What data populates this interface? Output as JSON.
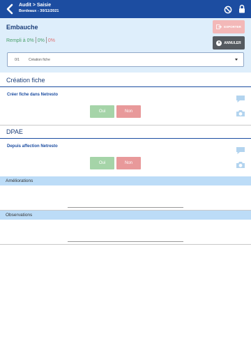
{
  "topbar": {
    "title": "Audit > Saisie",
    "subtitle": "Bordeaux - 30/11/2021",
    "icons": [
      "back-arrow",
      "ban",
      "lock"
    ]
  },
  "header": {
    "title": "Embauche",
    "fill_label": "Rempli à 0%",
    "fill_green": "0%",
    "fill_red": "0%",
    "export_label": "EXPORTER",
    "cancel_label": "ANNULER"
  },
  "select": {
    "number": "0/1",
    "text": "Création fiche"
  },
  "sections": [
    {
      "title": "Création fiche",
      "question": "Créer fiche dans Netresto",
      "yes_label": "Oui",
      "no_label": "Non"
    },
    {
      "title": "DPAE",
      "question": "Depuis affection Netresto",
      "yes_label": "Oui",
      "no_label": "Non"
    }
  ],
  "improvements_label": "Améliorations",
  "observations_label": "Observations",
  "colors": {
    "topbar": "#1c4da1",
    "header_bg": "#deeefb",
    "oui": "#a5d4a8",
    "non": "#e8999a",
    "light_bar": "#bcdcf7"
  }
}
